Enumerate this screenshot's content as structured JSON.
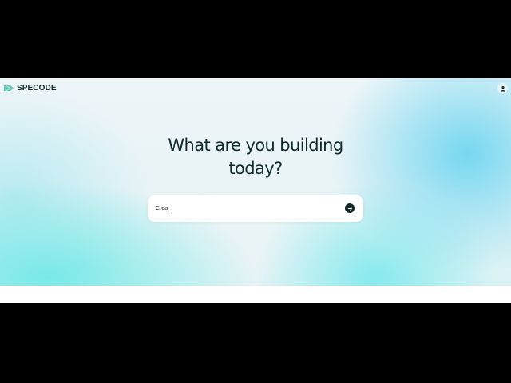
{
  "header": {
    "logo_text": "SPECODE",
    "logo_icon": "specode-logo-icon",
    "account_icon": "user-icon"
  },
  "hero": {
    "headline_line1": "What are you building",
    "headline_line2": "today?"
  },
  "prompt": {
    "value": "Crea",
    "send_icon": "arrow-right-icon"
  },
  "colors": {
    "brand_dark": "#0e2a2b",
    "logo_accent": "#5fc9b4",
    "hero_cyan": "#70d6f0",
    "hero_aqua": "#6ee8e6"
  }
}
